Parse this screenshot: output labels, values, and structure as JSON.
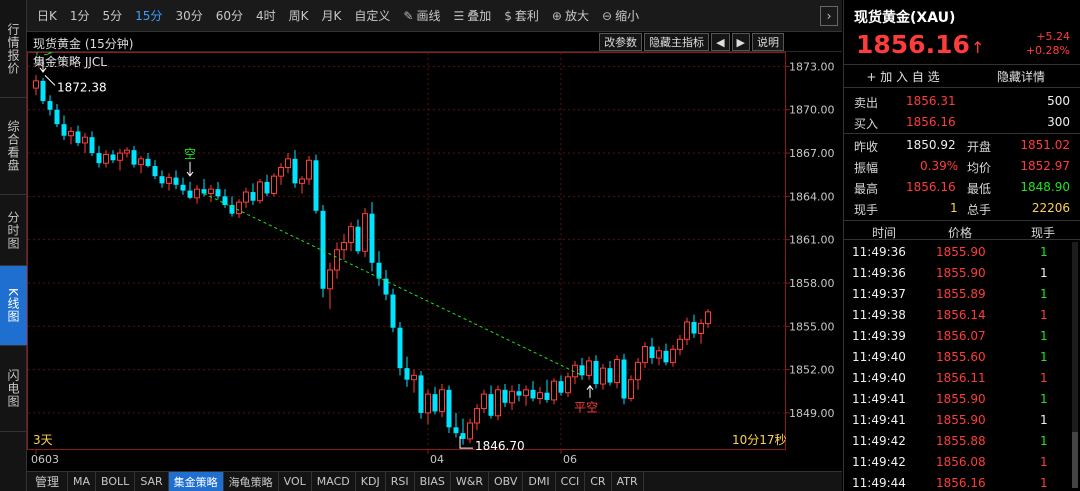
{
  "left_tabs": [
    {
      "label": "行情报价",
      "active": false
    },
    {
      "label": "综合看盘",
      "active": false
    },
    {
      "label": "分时图",
      "active": false
    },
    {
      "label": "K线图",
      "active": true
    },
    {
      "label": "闪电图",
      "active": false
    }
  ],
  "toolbar": {
    "periods": [
      "日K",
      "1分",
      "5分",
      "15分",
      "30分",
      "60分",
      "4时",
      "周K",
      "月K",
      "自定义"
    ],
    "active_period": "15分",
    "tools": [
      {
        "label": "画线",
        "icon": "pencil-icon"
      },
      {
        "label": "叠加",
        "icon": "layers-icon"
      },
      {
        "label": "套利",
        "icon": "money-bag-icon"
      },
      {
        "label": "放大",
        "icon": "zoom-in-icon"
      },
      {
        "label": "缩小",
        "icon": "zoom-out-icon"
      }
    ],
    "next_symbol": "›"
  },
  "chart_header": {
    "title": "现货黄金 (15分钟)",
    "buttons": [
      "改参数",
      "隐藏主指标",
      "◀",
      "▶",
      "说明"
    ],
    "strategy": "集金策略 JJCL"
  },
  "chart_data": {
    "type": "candlestick",
    "instrument": "现货黄金",
    "interval": "15分钟",
    "ylim": [
      1846.5,
      1874.0
    ],
    "y_ticks": [
      1849.0,
      1852.0,
      1855.0,
      1858.0,
      1861.0,
      1864.0,
      1867.0,
      1870.0,
      1873.0
    ],
    "y_tick_labels": [
      "1849.00",
      "1852.00",
      "1855.00",
      "1858.00",
      "1861.00",
      "1864.00",
      "1867.00",
      "1870.00",
      "1873.00"
    ],
    "x_labels": [
      {
        "index": 0,
        "label": "0603"
      },
      {
        "index": 56,
        "label": "04"
      },
      {
        "index": 75,
        "label": "06"
      }
    ],
    "ohlc": [
      [
        1871.5,
        1872.4,
        1871.0,
        1872.0
      ],
      [
        1872.0,
        1872.2,
        1870.4,
        1870.6
      ],
      [
        1870.6,
        1871.0,
        1869.6,
        1870.0
      ],
      [
        1870.0,
        1870.4,
        1868.8,
        1869.0
      ],
      [
        1869.0,
        1869.6,
        1867.9,
        1868.2
      ],
      [
        1868.2,
        1868.8,
        1867.6,
        1868.5
      ],
      [
        1868.5,
        1868.9,
        1867.5,
        1867.7
      ],
      [
        1867.7,
        1868.4,
        1867.0,
        1868.1
      ],
      [
        1868.1,
        1868.5,
        1866.8,
        1867.0
      ],
      [
        1867.0,
        1867.5,
        1866.0,
        1866.3
      ],
      [
        1866.3,
        1867.2,
        1866.0,
        1866.9
      ],
      [
        1866.9,
        1867.2,
        1866.3,
        1866.5
      ],
      [
        1866.5,
        1867.3,
        1865.8,
        1867.0
      ],
      [
        1867.0,
        1867.4,
        1866.7,
        1867.2
      ],
      [
        1867.2,
        1867.5,
        1866.0,
        1866.2
      ],
      [
        1866.2,
        1866.8,
        1865.6,
        1866.6
      ],
      [
        1866.6,
        1867.0,
        1866.0,
        1866.1
      ],
      [
        1866.1,
        1866.5,
        1865.2,
        1865.4
      ],
      [
        1865.4,
        1865.8,
        1864.6,
        1864.9
      ],
      [
        1864.9,
        1865.6,
        1864.4,
        1865.3
      ],
      [
        1865.3,
        1865.8,
        1864.5,
        1864.8
      ],
      [
        1864.8,
        1865.3,
        1864.1,
        1864.4
      ],
      [
        1864.4,
        1865.0,
        1863.8,
        1863.9
      ],
      [
        1863.9,
        1864.8,
        1863.5,
        1864.5
      ],
      [
        1864.5,
        1865.2,
        1864.0,
        1864.2
      ],
      [
        1864.2,
        1864.8,
        1863.6,
        1864.5
      ],
      [
        1864.5,
        1865.0,
        1863.8,
        1864.0
      ],
      [
        1864.0,
        1864.5,
        1863.2,
        1863.4
      ],
      [
        1863.4,
        1864.0,
        1862.6,
        1862.8
      ],
      [
        1862.8,
        1863.8,
        1862.5,
        1863.6
      ],
      [
        1863.6,
        1864.6,
        1863.2,
        1864.3
      ],
      [
        1864.3,
        1864.9,
        1863.4,
        1863.7
      ],
      [
        1863.7,
        1865.2,
        1863.5,
        1865.0
      ],
      [
        1865.0,
        1865.5,
        1864.0,
        1864.2
      ],
      [
        1864.2,
        1865.6,
        1864.0,
        1865.4
      ],
      [
        1865.4,
        1866.3,
        1864.8,
        1866.0
      ],
      [
        1866.0,
        1867.0,
        1865.6,
        1866.6
      ],
      [
        1866.6,
        1867.2,
        1864.6,
        1864.9
      ],
      [
        1864.9,
        1865.4,
        1864.2,
        1865.2
      ],
      [
        1865.2,
        1866.8,
        1864.8,
        1866.5
      ],
      [
        1866.5,
        1866.9,
        1862.8,
        1863.0
      ],
      [
        1863.0,
        1863.4,
        1857.0,
        1857.6
      ],
      [
        1857.6,
        1859.4,
        1856.2,
        1858.9
      ],
      [
        1858.9,
        1860.8,
        1858.3,
        1860.3
      ],
      [
        1860.3,
        1861.4,
        1859.6,
        1860.8
      ],
      [
        1860.8,
        1862.2,
        1860.2,
        1861.9
      ],
      [
        1861.9,
        1862.4,
        1860.0,
        1860.2
      ],
      [
        1860.2,
        1863.2,
        1859.8,
        1862.8
      ],
      [
        1862.8,
        1863.6,
        1858.8,
        1859.4
      ],
      [
        1859.4,
        1860.2,
        1857.8,
        1858.3
      ],
      [
        1858.3,
        1858.9,
        1856.8,
        1857.2
      ],
      [
        1857.2,
        1857.6,
        1854.6,
        1854.9
      ],
      [
        1854.9,
        1855.3,
        1851.6,
        1852.1
      ],
      [
        1852.1,
        1852.9,
        1850.8,
        1851.3
      ],
      [
        1851.3,
        1852.0,
        1850.4,
        1851.6
      ],
      [
        1851.6,
        1851.9,
        1848.6,
        1849.0
      ],
      [
        1849.0,
        1850.6,
        1848.2,
        1850.3
      ],
      [
        1850.3,
        1850.8,
        1848.9,
        1849.1
      ],
      [
        1849.1,
        1851.0,
        1848.7,
        1850.6
      ],
      [
        1850.6,
        1850.9,
        1847.6,
        1848.0
      ],
      [
        1848.0,
        1849.0,
        1847.3,
        1847.6
      ],
      [
        1847.6,
        1848.6,
        1846.8,
        1847.2
      ],
      [
        1847.2,
        1848.6,
        1846.9,
        1848.3
      ],
      [
        1848.3,
        1849.6,
        1847.8,
        1849.3
      ],
      [
        1849.3,
        1850.6,
        1849.0,
        1850.3
      ],
      [
        1850.3,
        1850.9,
        1848.6,
        1848.8
      ],
      [
        1848.8,
        1850.9,
        1848.5,
        1850.6
      ],
      [
        1850.6,
        1851.0,
        1849.4,
        1849.7
      ],
      [
        1849.7,
        1850.9,
        1849.2,
        1850.5
      ],
      [
        1850.5,
        1851.0,
        1849.8,
        1850.2
      ],
      [
        1850.2,
        1850.9,
        1849.5,
        1850.6
      ],
      [
        1850.6,
        1851.2,
        1849.8,
        1850.0
      ],
      [
        1850.0,
        1850.8,
        1849.6,
        1850.4
      ],
      [
        1850.4,
        1851.3,
        1849.7,
        1849.9
      ],
      [
        1849.9,
        1851.4,
        1849.6,
        1851.2
      ],
      [
        1851.2,
        1851.6,
        1850.2,
        1850.4
      ],
      [
        1850.4,
        1851.8,
        1850.1,
        1851.5
      ],
      [
        1851.5,
        1852.6,
        1851.0,
        1852.3
      ],
      [
        1852.3,
        1852.8,
        1851.3,
        1851.6
      ],
      [
        1851.6,
        1852.9,
        1851.3,
        1852.6
      ],
      [
        1852.6,
        1853.0,
        1850.7,
        1851.0
      ],
      [
        1851.0,
        1852.4,
        1850.6,
        1852.1
      ],
      [
        1852.1,
        1852.6,
        1850.9,
        1851.1
      ],
      [
        1851.1,
        1853.0,
        1850.7,
        1852.7
      ],
      [
        1852.7,
        1853.1,
        1849.6,
        1850.0
      ],
      [
        1850.0,
        1851.6,
        1849.8,
        1851.3
      ],
      [
        1851.3,
        1852.8,
        1850.6,
        1852.5
      ],
      [
        1852.5,
        1853.9,
        1852.1,
        1853.6
      ],
      [
        1853.6,
        1854.2,
        1852.4,
        1852.8
      ],
      [
        1852.8,
        1853.6,
        1852.3,
        1853.3
      ],
      [
        1853.3,
        1853.8,
        1852.3,
        1852.5
      ],
      [
        1852.5,
        1853.7,
        1852.2,
        1853.4
      ],
      [
        1853.4,
        1854.4,
        1853.0,
        1854.1
      ],
      [
        1854.1,
        1855.6,
        1853.7,
        1855.3
      ],
      [
        1855.3,
        1855.8,
        1854.2,
        1854.5
      ],
      [
        1854.5,
        1855.5,
        1853.8,
        1855.2
      ],
      [
        1855.2,
        1856.2,
        1854.9,
        1856.0
      ]
    ],
    "trend_line": {
      "start_index": 24,
      "start_value": 1864.2,
      "end_index": 78,
      "end_value": 1851.6,
      "color": "#1ee61e",
      "style": "dashed"
    },
    "signals": [
      {
        "index": 1,
        "text": "平多",
        "direction": "down",
        "color": "#1ee61e"
      },
      {
        "index": 22,
        "text": "空",
        "direction": "down",
        "color": "#1ee61e"
      },
      {
        "index": 78,
        "text": "平空",
        "direction": "up",
        "color": "#ff3c3c"
      }
    ],
    "high_marker": {
      "index": 1,
      "value": 1872.38,
      "label": "1872.38"
    },
    "low_marker": {
      "index": 61,
      "value": 1846.7,
      "label": "1846.70"
    },
    "colors": {
      "up": "#ff3c3c",
      "down": "#00e5ff",
      "grid": "#5a1010",
      "axis": "#8b1a1a"
    },
    "period_label": "3天",
    "countdown": "10分17秒"
  },
  "indicator_tabs": [
    {
      "label": "管理",
      "active": false
    },
    {
      "label": "MA",
      "active": false
    },
    {
      "label": "BOLL",
      "active": false
    },
    {
      "label": "SAR",
      "active": false
    },
    {
      "label": "集金策略",
      "active": true
    },
    {
      "label": "海龟策略",
      "active": false
    },
    {
      "label": "VOL",
      "active": false
    },
    {
      "label": "MACD",
      "active": false
    },
    {
      "label": "KDJ",
      "active": false
    },
    {
      "label": "RSI",
      "active": false
    },
    {
      "label": "BIAS",
      "active": false
    },
    {
      "label": "W&R",
      "active": false
    },
    {
      "label": "OBV",
      "active": false
    },
    {
      "label": "DMI",
      "active": false
    },
    {
      "label": "CCI",
      "active": false
    },
    {
      "label": "CR",
      "active": false
    },
    {
      "label": "ATR",
      "active": false
    }
  ],
  "quote": {
    "name": "现货黄金(XAU)",
    "price": "1856.16",
    "arrow": "↑",
    "change": "+5.24",
    "change_pct": "+0.28%",
    "add_watch": "+ 加 入 自 选",
    "hide_detail": "隐藏详情",
    "sell_label": "卖出",
    "sell_price": "1856.31",
    "sell_qty": "500",
    "buy_label": "买入",
    "buy_price": "1856.16",
    "buy_qty": "300",
    "prev_close_label": "昨收",
    "prev_close": "1850.92",
    "open_label": "开盘",
    "open": "1851.02",
    "amplitude_label": "振幅",
    "amplitude": "0.39%",
    "avg_label": "均价",
    "avg": "1852.97",
    "high_label": "最高",
    "high": "1856.16",
    "low_label": "最低",
    "low": "1848.90",
    "cur_vol_label": "现手",
    "cur_vol": "1",
    "total_vol_label": "总手",
    "total_vol": "22206"
  },
  "ticks_header": [
    "时间",
    "价格",
    "现手"
  ],
  "ticks": [
    {
      "time": "11:49:36",
      "price": "1855.90",
      "vol": "1",
      "vol_color": "green"
    },
    {
      "time": "11:49:36",
      "price": "1855.90",
      "vol": "1",
      "vol_color": "white"
    },
    {
      "time": "11:49:37",
      "price": "1855.89",
      "vol": "1",
      "vol_color": "green"
    },
    {
      "time": "11:49:38",
      "price": "1856.14",
      "vol": "1",
      "vol_color": "red"
    },
    {
      "time": "11:49:39",
      "price": "1856.07",
      "vol": "1",
      "vol_color": "green"
    },
    {
      "time": "11:49:40",
      "price": "1855.60",
      "vol": "1",
      "vol_color": "green"
    },
    {
      "time": "11:49:40",
      "price": "1856.11",
      "vol": "1",
      "vol_color": "red"
    },
    {
      "time": "11:49:41",
      "price": "1855.90",
      "vol": "1",
      "vol_color": "green"
    },
    {
      "time": "11:49:41",
      "price": "1855.90",
      "vol": "1",
      "vol_color": "white"
    },
    {
      "time": "11:49:42",
      "price": "1855.88",
      "vol": "1",
      "vol_color": "green"
    },
    {
      "time": "11:49:42",
      "price": "1856.08",
      "vol": "1",
      "vol_color": "red"
    },
    {
      "time": "11:49:44",
      "price": "1856.16",
      "vol": "1",
      "vol_color": "red"
    }
  ]
}
